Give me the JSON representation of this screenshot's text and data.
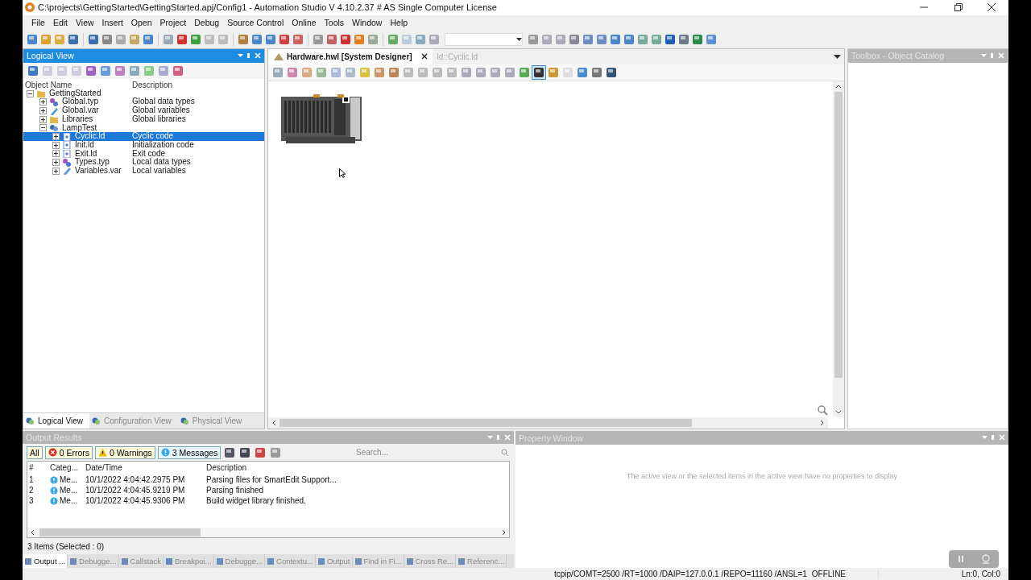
{
  "window": {
    "title": "C:\\projects\\GettingStarted\\GettingStarted.apj/Config1 - Automation Studio V 4.10.2.37 # AS Single Computer License"
  },
  "menu": [
    "File",
    "Edit",
    "View",
    "Insert",
    "Open",
    "Project",
    "Debug",
    "Source Control",
    "Online",
    "Tools",
    "Window",
    "Help"
  ],
  "logical_view": {
    "title": "Logical View",
    "active": true,
    "columns": [
      "Object Name",
      "Description"
    ],
    "tree": [
      {
        "name": "GettingStarted",
        "kind": "folder",
        "expanded": true,
        "selected": false,
        "children": [
          {
            "name": "Global.typ",
            "description": "Global data types",
            "kind": "types",
            "expanded": false,
            "selected": false
          },
          {
            "name": "Global.var",
            "description": "Global variables",
            "kind": "variables",
            "expanded": false,
            "selected": false
          },
          {
            "name": "Libraries",
            "description": "Global libraries",
            "kind": "folder",
            "expanded": false,
            "selected": false
          },
          {
            "name": "LampTest",
            "kind": "package",
            "expanded": true,
            "selected": false,
            "children": [
              {
                "name": "Cyclic.ld",
                "description": "Cyclic code",
                "kind": "code",
                "expanded": false,
                "selected": true
              },
              {
                "name": "Init.ld",
                "description": "Initialization code",
                "kind": "code",
                "expanded": false,
                "selected": false
              },
              {
                "name": "Exit.ld",
                "description": "Exit code",
                "kind": "code",
                "expanded": false,
                "selected": false
              },
              {
                "name": "Types.typ",
                "description": "Local data types",
                "kind": "types",
                "expanded": false,
                "selected": false
              },
              {
                "name": "Variables.var",
                "description": "Local variables",
                "kind": "variables",
                "expanded": false,
                "selected": false
              }
            ]
          }
        ]
      }
    ],
    "tabs": [
      {
        "label": "Logical View",
        "selected": true
      },
      {
        "label": "Configuration View",
        "selected": false
      },
      {
        "label": "Physical View",
        "selected": false
      }
    ]
  },
  "editor": {
    "tabs": [
      {
        "label": "Hardware.hwl [System Designer]",
        "selected": true
      },
      {
        "label": "ld::Cyclic.ld",
        "selected": false
      }
    ]
  },
  "toolbox": {
    "title": "Toolbox - Object Catalog",
    "active": false
  },
  "output": {
    "title": "Output Results",
    "active": false,
    "filters": [
      {
        "kind": "all",
        "label": "All"
      },
      {
        "kind": "error",
        "label": "0 Errors"
      },
      {
        "kind": "warning",
        "label": "0 Warnings"
      },
      {
        "kind": "info",
        "label": "3 Messages"
      }
    ],
    "search": {
      "placeholder": "Search..."
    },
    "columns": [
      "#",
      "Categ...",
      "Date/Time",
      "Description"
    ],
    "rows": [
      {
        "number": "1",
        "category": "Me...",
        "time": "10/1/2022 4:04:42.2975 PM",
        "description": "Parsing files for SmartEdit Support..."
      },
      {
        "number": "2",
        "category": "Me...",
        "time": "10/1/2022 4:04:45.9219 PM",
        "description": "Parsing finished"
      },
      {
        "number": "3",
        "category": "Me...",
        "time": "10/1/2022 4:04:45.9306 PM",
        "description": "Build widget library finished."
      }
    ],
    "summary": "3 Items (Selected : 0)",
    "tabs": [
      {
        "label": "Output ...",
        "selected": true
      },
      {
        "label": "Debugge...",
        "selected": false
      },
      {
        "label": "Callstack",
        "selected": false
      },
      {
        "label": "Breakpoi...",
        "selected": false
      },
      {
        "label": "Debugge...",
        "selected": false
      },
      {
        "label": "Contextu...",
        "selected": false
      },
      {
        "label": "Output",
        "selected": false
      },
      {
        "label": "Find in Fi...",
        "selected": false
      },
      {
        "label": "Cross Re...",
        "selected": false
      },
      {
        "label": "Referenc...",
        "selected": false
      }
    ]
  },
  "property_window": {
    "title": "Property Window",
    "active": false,
    "message": "The active view or the selected items in the active view have no properties to display"
  },
  "status_bar": {
    "connection": "tcpip/COMT=2500 /RT=1000 /DAIP=127.0.0.1 /REPO=11160 /ANSL=1",
    "mode": "OFFLINE",
    "position": "Ln:0, Col:0"
  }
}
